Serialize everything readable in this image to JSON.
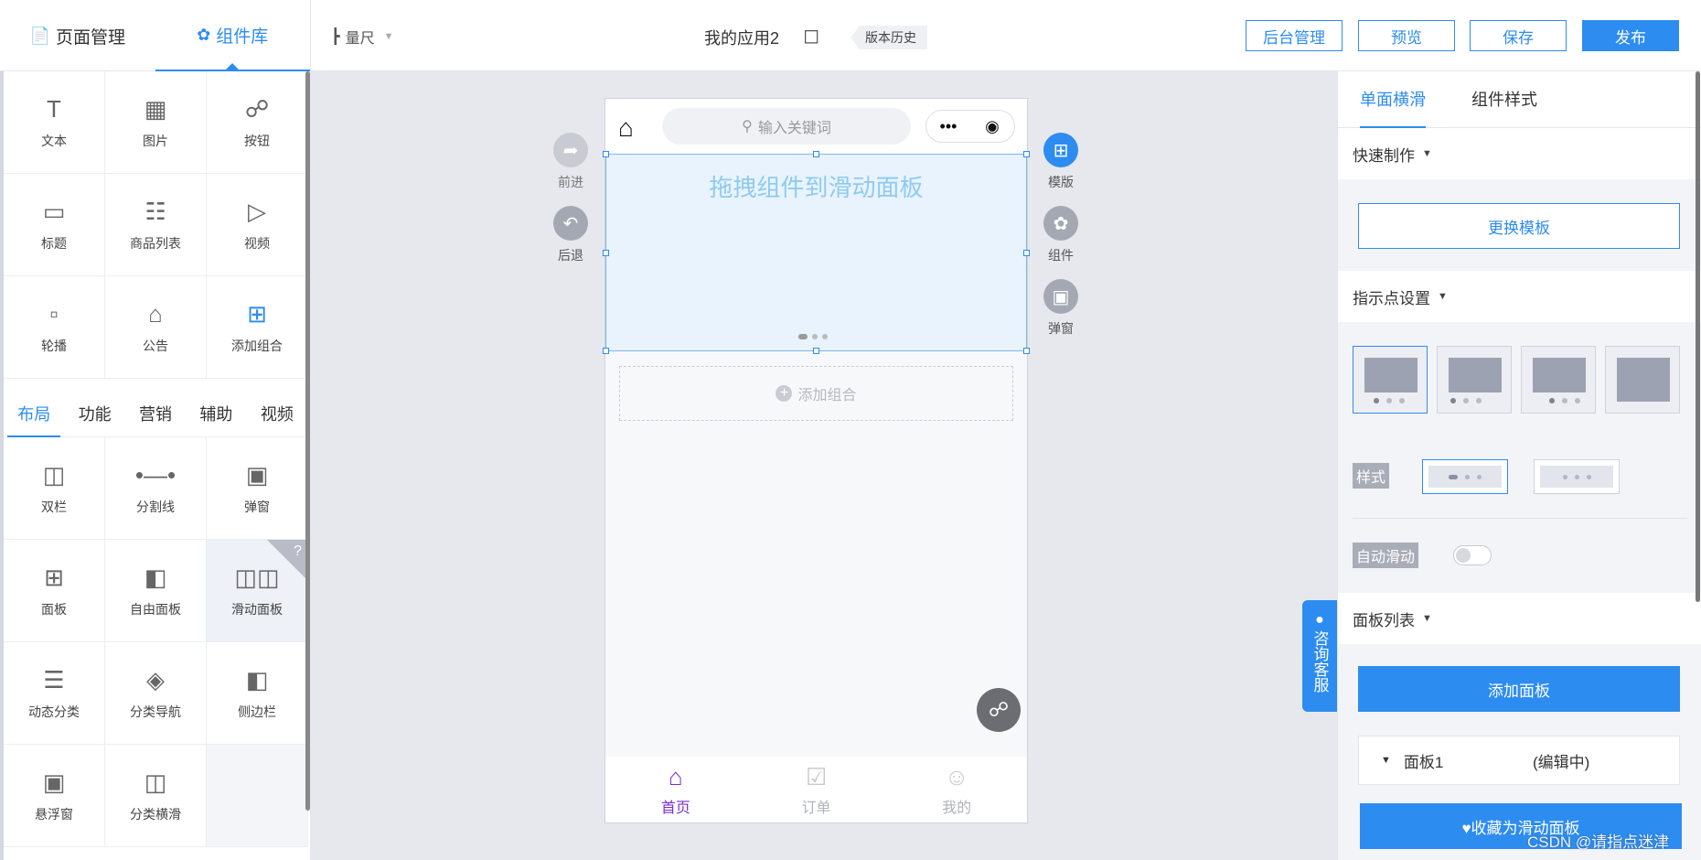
{
  "left_tabs": [
    {
      "label": "页面管理",
      "icon": "file-icon",
      "active": false
    },
    {
      "label": "组件库",
      "icon": "puzzle-icon",
      "active": true
    }
  ],
  "toolbar": {
    "ruler_label": "量尺",
    "app_title": "我的应用2",
    "history_label": "版本历史",
    "buttons": {
      "admin": "后台管理",
      "preview": "预览",
      "save": "保存",
      "publish": "发布"
    }
  },
  "basic_components": [
    {
      "label": "文本",
      "icon": "text-icon"
    },
    {
      "label": "图片",
      "icon": "image-icon"
    },
    {
      "label": "按钮",
      "icon": "button-icon"
    },
    {
      "label": "标题",
      "icon": "title-icon"
    },
    {
      "label": "商品列表",
      "icon": "product-list-icon"
    },
    {
      "label": "视频",
      "icon": "video-icon"
    },
    {
      "label": "轮播",
      "icon": "carousel-icon"
    },
    {
      "label": "公告",
      "icon": "notice-icon"
    },
    {
      "label": "添加组合",
      "icon": "add-group-icon"
    }
  ],
  "category_tabs": [
    "布局",
    "功能",
    "营销",
    "辅助",
    "视频"
  ],
  "active_category": "布局",
  "layout_components": [
    {
      "label": "双栏",
      "icon": "two-column-icon"
    },
    {
      "label": "分割线",
      "icon": "divider-icon"
    },
    {
      "label": "弹窗",
      "icon": "popup-icon"
    },
    {
      "label": "面板",
      "icon": "panel-icon"
    },
    {
      "label": "自由面板",
      "icon": "free-panel-icon"
    },
    {
      "label": "滑动面板",
      "icon": "slide-panel-icon",
      "selected": true,
      "help": "?"
    },
    {
      "label": "动态分类",
      "icon": "dynamic-category-icon"
    },
    {
      "label": "分类导航",
      "icon": "category-nav-icon"
    },
    {
      "label": "侧边栏",
      "icon": "sidebar-icon"
    },
    {
      "label": "悬浮窗",
      "icon": "float-window-icon"
    },
    {
      "label": "分类横滑",
      "icon": "category-scroll-icon"
    }
  ],
  "canvas": {
    "search_placeholder": "输入关键词",
    "capsule_more": "•••",
    "capsule_target": "◉",
    "slider_hint": "拖拽组件到滑动面板",
    "add_group": "添加组合",
    "tabbar": [
      {
        "label": "首页",
        "icon": "home-tab-icon",
        "active": true
      },
      {
        "label": "订单",
        "icon": "order-tab-icon",
        "active": false
      },
      {
        "label": "我的",
        "icon": "profile-tab-icon",
        "active": false
      }
    ]
  },
  "canvas_left_actions": [
    {
      "label": "前进",
      "icon": "forward-icon"
    },
    {
      "label": "后退",
      "icon": "back-icon"
    }
  ],
  "canvas_right_actions": [
    {
      "label": "模版",
      "icon": "template-icon"
    },
    {
      "label": "组件",
      "icon": "component-icon"
    },
    {
      "label": "弹窗",
      "icon": "popup-icon"
    }
  ],
  "right_panel": {
    "tabs": [
      "单面横滑",
      "组件样式"
    ],
    "active_tab": "单面横滑",
    "quick_make": "快速制作",
    "change_template": "更换模板",
    "indicator_settings": "指示点设置",
    "style_label": "样式",
    "autoplay_label": "自动滑动",
    "autoplay_on": false,
    "panel_list": "面板列表",
    "add_panel": "添加面板",
    "panel_item_name": "面板1",
    "panel_item_status": "(编辑中)",
    "favorite_button": "♥收藏为滑动面板"
  },
  "consult_label": "咨询客服",
  "watermark": "CSDN @请指点迷津",
  "colors": {
    "accent": "#2d8cf0",
    "tab_active": "#7b2fd0",
    "slider_bg": "#e8f3fd"
  }
}
